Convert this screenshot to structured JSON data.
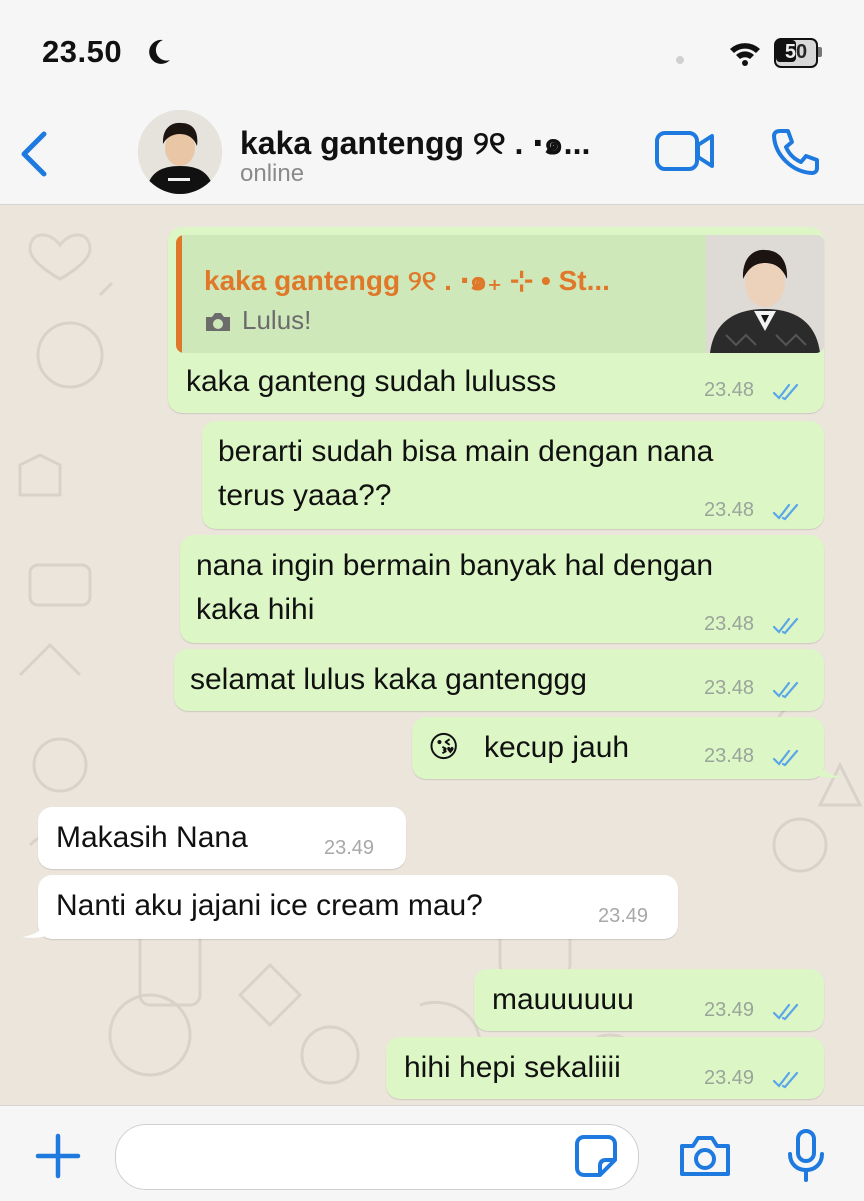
{
  "status_bar": {
    "time": "23.50",
    "battery": "50"
  },
  "header": {
    "contact_name": "kaka gantengg ୨୧ . ‧₊˚ ⊹ ...",
    "contact_name_display": "kaka gantengg ୨୧ . ‧๑...",
    "status": "online"
  },
  "messages": [
    {
      "id": "m1",
      "direction": "out",
      "quote": {
        "author": "kaka gantengg ୨୧ . ‧๑₊ ⊹  • St...",
        "text": "Lulus!"
      },
      "text": "kaka ganteng sudah lulusss",
      "time": "23.48",
      "status": "read"
    },
    {
      "id": "m2",
      "direction": "out",
      "lines": [
        "berarti sudah bisa main dengan nana",
        "terus yaaa??"
      ],
      "time": "23.48",
      "status": "read"
    },
    {
      "id": "m3",
      "direction": "out",
      "lines": [
        "nana ingin bermain banyak hal dengan",
        "kaka hihi"
      ],
      "time": "23.48",
      "status": "read"
    },
    {
      "id": "m4",
      "direction": "out",
      "text": "selamat lulus kaka gantenggg",
      "time": "23.48",
      "status": "read"
    },
    {
      "id": "m5",
      "direction": "out",
      "emoji": "😘",
      "text": "kecup jauh",
      "time": "23.48",
      "status": "read"
    },
    {
      "id": "m6",
      "direction": "in",
      "text": "Makasih Nana",
      "time": "23.49"
    },
    {
      "id": "m7",
      "direction": "in",
      "text": "Nanti aku jajani ice cream mau?",
      "time": "23.49"
    },
    {
      "id": "m8",
      "direction": "out",
      "text": "mauuuuuu",
      "time": "23.49",
      "status": "read"
    },
    {
      "id": "m9",
      "direction": "out",
      "text": "hihi hepi sekaliiii",
      "time": "23.49",
      "status": "read"
    }
  ],
  "input": {
    "placeholder": ""
  },
  "icons": {
    "back": "chevron-left-icon",
    "video": "video-camera-icon",
    "call": "phone-icon",
    "plus": "plus-icon",
    "sticker": "sticker-icon",
    "camera": "camera-icon",
    "mic": "microphone-icon",
    "read": "double-check-icon"
  },
  "colors": {
    "accent": "#1f7ae0",
    "outgoing_bubble": "#dcf6c6",
    "incoming_bubble": "#ffffff",
    "chat_background": "#ebe5dc",
    "quote_author": "#e0782a",
    "read_ticks": "#5aa6e8"
  }
}
